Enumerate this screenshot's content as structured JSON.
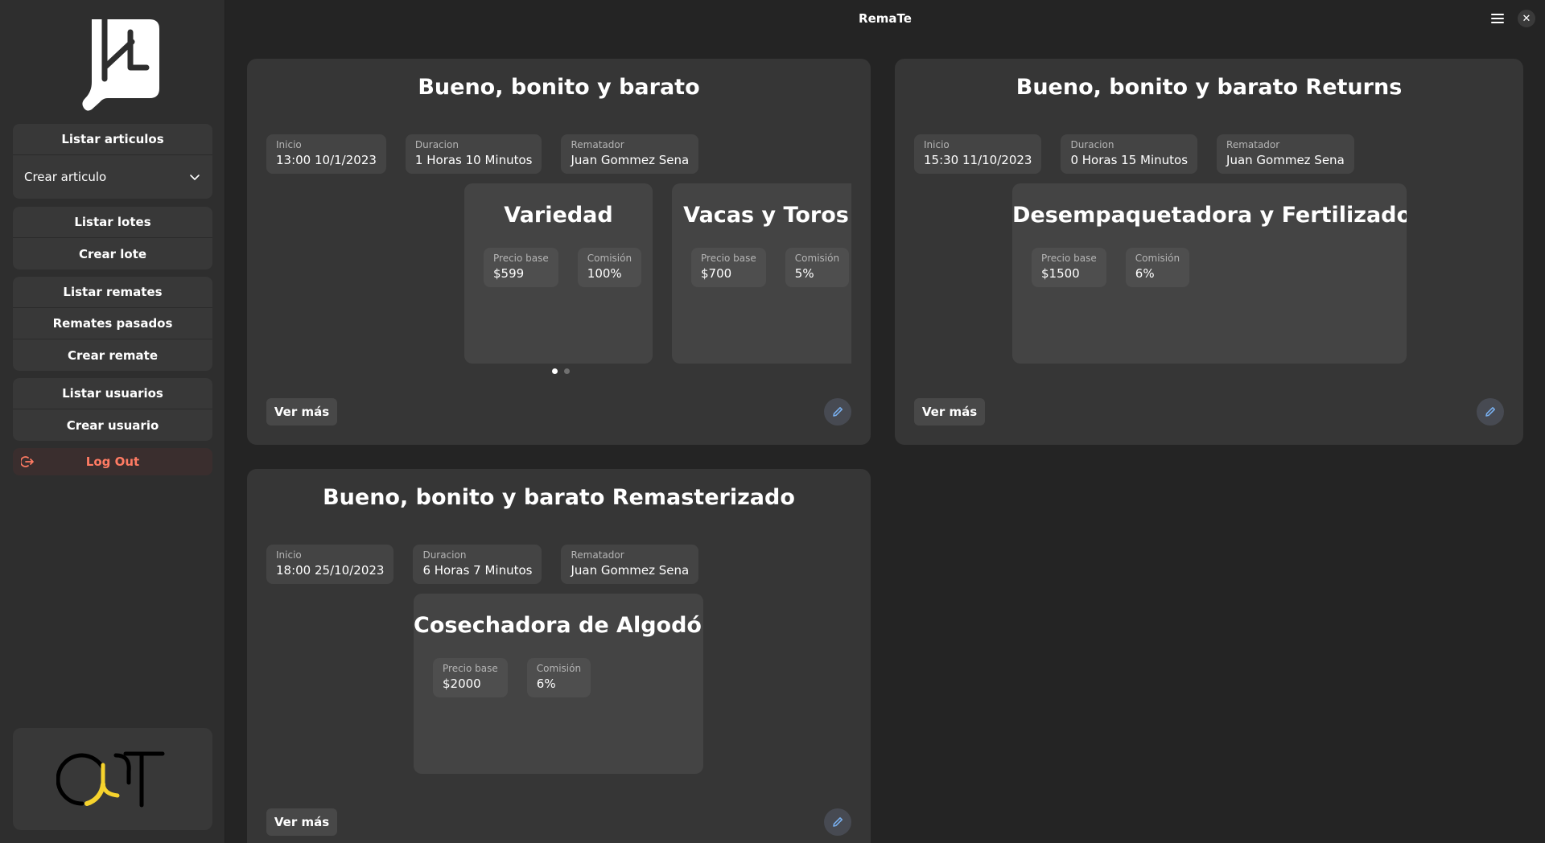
{
  "app": {
    "title": "RemaTe"
  },
  "sidebar": {
    "groups": [
      {
        "items": [
          {
            "label": "Listar articulos"
          },
          {
            "label": "Crear articulo"
          }
        ]
      },
      {
        "items": [
          {
            "label": "Listar lotes"
          },
          {
            "label": "Crear lote"
          }
        ]
      },
      {
        "items": [
          {
            "label": "Listar remates"
          },
          {
            "label": "Remates pasados"
          },
          {
            "label": "Crear remate"
          }
        ]
      },
      {
        "items": [
          {
            "label": "Listar usuarios"
          },
          {
            "label": "Crear usuario"
          }
        ]
      }
    ],
    "logout_label": "Log Out"
  },
  "colors": {
    "logout": "#ff7b63",
    "edit_icon": "#78aeed",
    "logo_yellow": "#f6d32d"
  },
  "auctions": [
    {
      "title": "Bueno, bonito y barato",
      "inicio_label": "Inicio",
      "inicio": "13:00 10/1/2023",
      "duracion_label": "Duracion",
      "duracion": "1 Horas 10 Minutos",
      "rematador_label": "Rematador",
      "rematador": "Juan Gommez Sena",
      "articles": [
        {
          "title": "Variedad",
          "precio_label": "Precio base",
          "precio": "$599",
          "comision_label": "Comisión",
          "comision": "100%"
        },
        {
          "title": "Vacas y Toros",
          "precio_label": "Precio base",
          "precio": "$700",
          "comision_label": "Comisión",
          "comision": "5%"
        }
      ],
      "ver_mas": "Ver más"
    },
    {
      "title": "Bueno, bonito y barato Returns",
      "inicio_label": "Inicio",
      "inicio": "15:30 11/10/2023",
      "duracion_label": "Duracion",
      "duracion": "0 Horas 15 Minutos",
      "rematador_label": "Rematador",
      "rematador": "Juan Gommez Sena",
      "articles": [
        {
          "title": "Desempaquetadora y Fertilizadora",
          "precio_label": "Precio base",
          "precio": "$1500",
          "comision_label": "Comisión",
          "comision": "6%"
        }
      ],
      "ver_mas": "Ver más"
    },
    {
      "title": "Bueno, bonito y barato Remasterizado",
      "inicio_label": "Inicio",
      "inicio": "18:00 25/10/2023",
      "duracion_label": "Duracion",
      "duracion": "6 Horas 7 Minutos",
      "rematador_label": "Rematador",
      "rematador": "Juan Gommez Sena",
      "articles": [
        {
          "title": "Cosechadora de Algodón",
          "precio_label": "Precio base",
          "precio": "$2000",
          "comision_label": "Comisión",
          "comision": "6%"
        }
      ],
      "ver_mas": "Ver más"
    }
  ]
}
